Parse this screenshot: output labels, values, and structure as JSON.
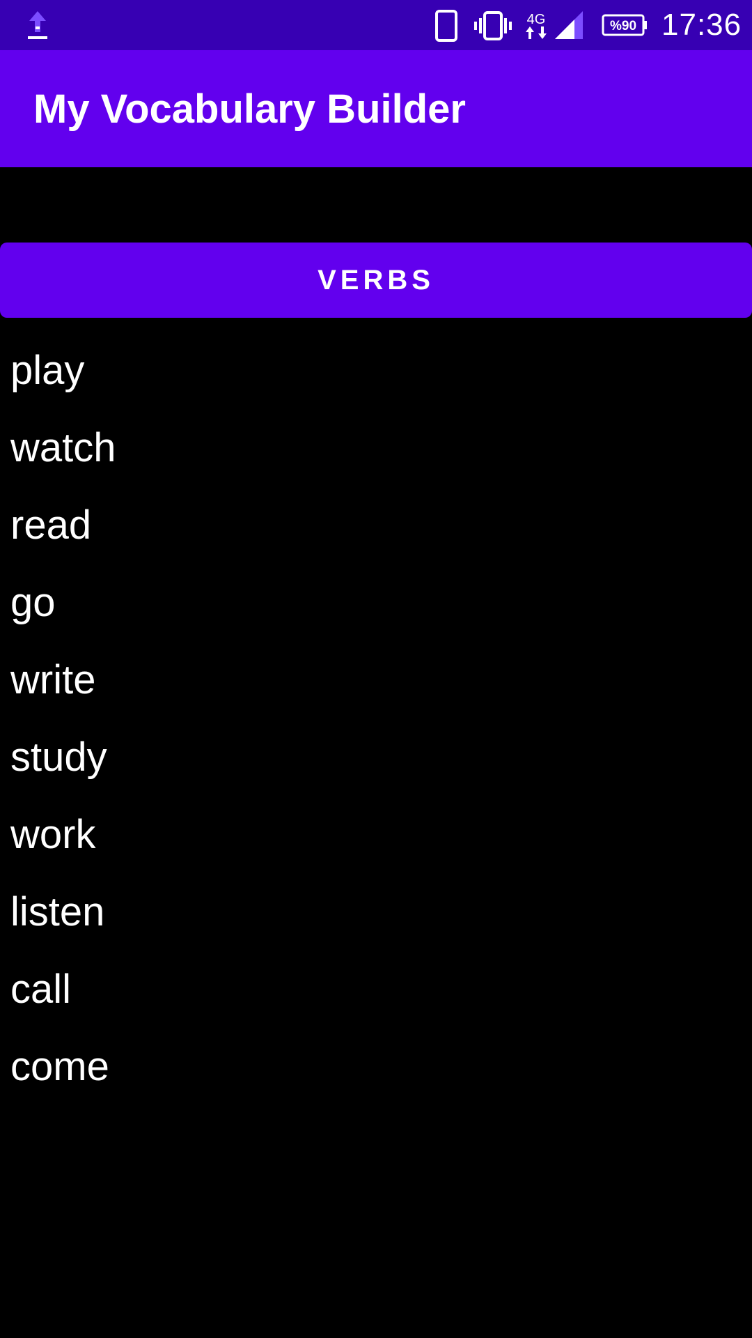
{
  "status_bar": {
    "time": "17:36",
    "battery": "%90",
    "network": "4G",
    "icons": [
      "upload-icon",
      "phone-icon",
      "vibrate-icon",
      "network-4g-icon",
      "signal-icon",
      "battery-icon"
    ]
  },
  "app_bar": {
    "title": "My Vocabulary Builder"
  },
  "verbs_button": {
    "label": "VERBS"
  },
  "words": [
    "play",
    "watch",
    "read",
    "go",
    "write",
    "study",
    "work",
    "listen",
    "call",
    "come"
  ],
  "colors": {
    "status_bar": "#3700b3",
    "primary": "#6200ee",
    "background": "#000000",
    "text": "#ffffff"
  }
}
